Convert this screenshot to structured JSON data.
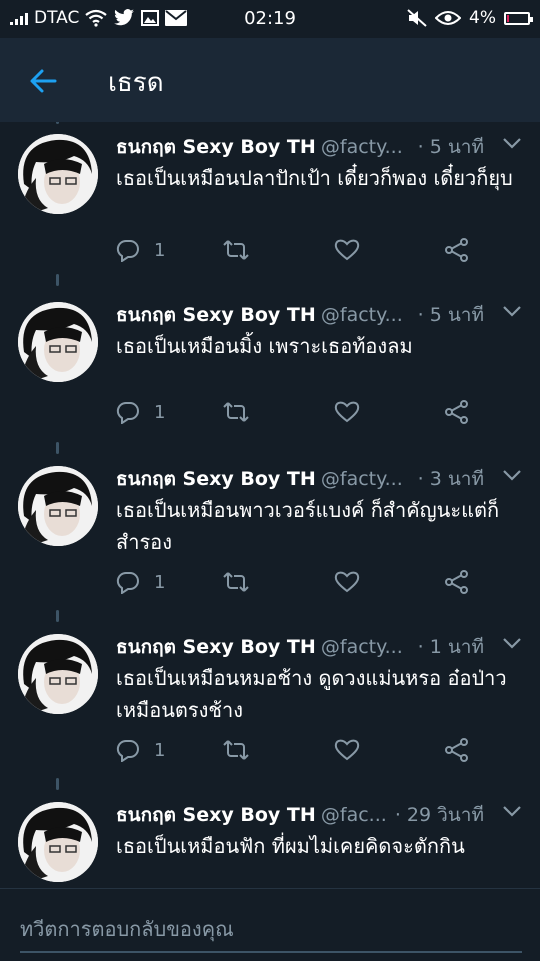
{
  "status_bar": {
    "carrier": "DTAC",
    "time": "02:19",
    "battery": "4%",
    "battery_level": 0.04,
    "icons": [
      "signal-icon",
      "wifi-icon",
      "twitter-icon",
      "gallery-icon",
      "mail-icon",
      "mute-icon",
      "eye-icon",
      "battery-icon"
    ]
  },
  "app_bar": {
    "back_icon": "back-arrow-icon",
    "title": "เธรด"
  },
  "colors": {
    "background": "#141d26",
    "app_bar": "#1b2836",
    "accent": "#1da1f2",
    "muted": "#8899a6"
  },
  "tweets": [
    {
      "name": "ธนกฤต Sexy Boy TH",
      "handle": "@facty...",
      "time": "· 5 นาที",
      "text": "เธอเป็นเหมือนปลาปักเป้า เดี๋ยวก็พอง เดี๋ยวก็ยุบ",
      "replies": "1"
    },
    {
      "name": "ธนกฤต Sexy Boy TH",
      "handle": "@facty...",
      "time": "· 5 นาที",
      "text": "เธอเป็นเหมือนมิ้ง เพราะเธอท้องลม",
      "replies": "1"
    },
    {
      "name": "ธนกฤต Sexy Boy TH",
      "handle": "@facty...",
      "time": "· 3 นาที",
      "text": "เธอเป็นเหมือนพาวเวอร์แบงค์ ก็สำคัญนะแต่ก็สำรอง",
      "replies": "1"
    },
    {
      "name": "ธนกฤต Sexy Boy TH",
      "handle": "@facty...",
      "time": "· 1 นาที",
      "text": "เธอเป็นเหมือนหมอช้าง ดูดวงแม่นหรอ อ๋อป่าวเหมือนตรงช้าง",
      "replies": "1"
    },
    {
      "name": "ธนกฤต Sexy Boy TH",
      "handle": "@fac...",
      "time": "· 29 วินาที",
      "text": "เธอเป็นเหมือนฟัก ที่ผมไม่เคยคิดจะตักกิน",
      "replies": ""
    }
  ],
  "compose": {
    "placeholder": "ทวีตการตอบกลับของคุณ"
  }
}
